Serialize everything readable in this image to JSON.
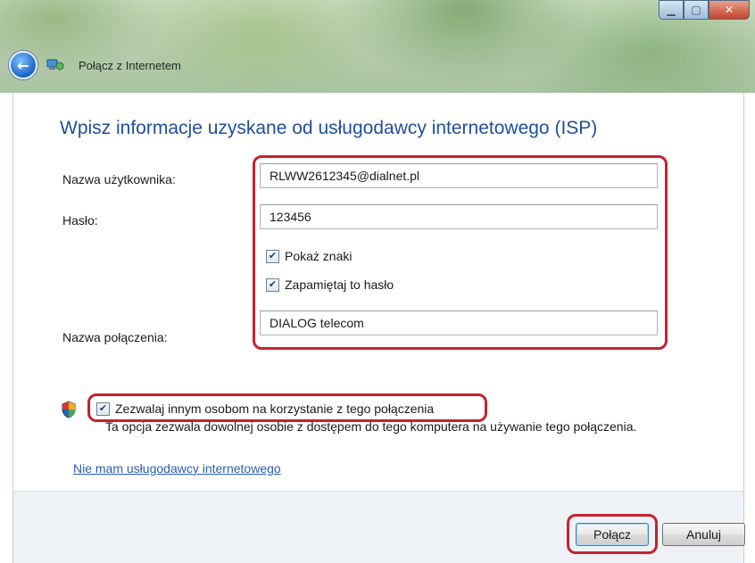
{
  "window": {
    "title": "Połącz z Internetem",
    "controls": [
      "minimize",
      "maximize",
      "close"
    ]
  },
  "main": {
    "heading": "Wpisz informacje uzyskane od usługodawcy internetowego (ISP)",
    "username": {
      "label": "Nazwa użytkownika:",
      "value": "RLWW2612345@dialnet.pl"
    },
    "password": {
      "label": "Hasło:",
      "value": "123456"
    },
    "show_chars": {
      "label": "Pokaż znaki",
      "checked": true
    },
    "remember": {
      "label": "Zapamiętaj to hasło",
      "checked": true
    },
    "connection_name": {
      "label": "Nazwa połączenia:",
      "value": "DIALOG telecom"
    },
    "allow_others": {
      "label": "Zezwalaj innym osobom na korzystanie z tego połączenia",
      "checked": true
    },
    "allow_desc": "Ta opcja zezwala dowolnej osobie z dostępem do tego komputera na używanie tego połączenia.",
    "no_isp_link": "Nie mam usługodawcy internetowego"
  },
  "footer": {
    "connect_label": "Połącz",
    "cancel_label": "Anuluj"
  },
  "colors": {
    "highlight": "#c4222f",
    "heading": "#1f4f9a",
    "link": "#2a5db0"
  },
  "icons": [
    "back-arrow-icon",
    "network-connection-icon",
    "shield-icon",
    "checkmark-icon"
  ]
}
